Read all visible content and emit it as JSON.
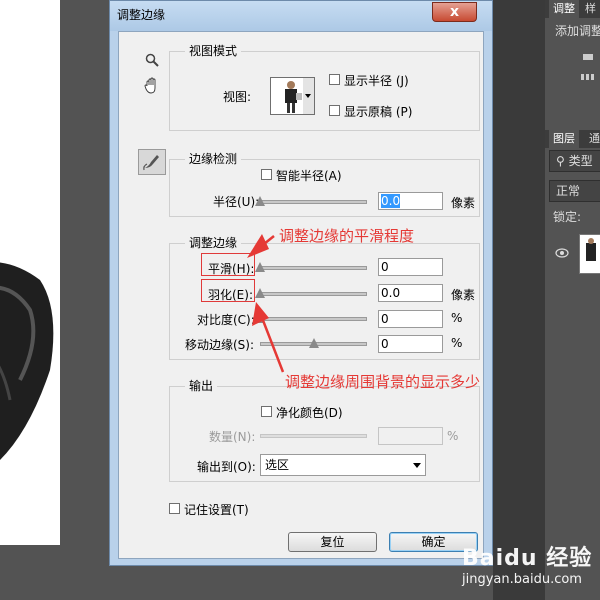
{
  "right_panel": {
    "tabs_top": [
      "调整",
      "样"
    ],
    "add_adjustment": "添加调整",
    "tabs_layers": [
      "图层",
      "通"
    ],
    "kind_filter": "类型",
    "blend_mode": "正常",
    "lock_label": "锁定:"
  },
  "dialog": {
    "title": "调整边缘",
    "close_label": "x",
    "view_mode": {
      "group_title": "视图模式",
      "view_label": "视图:",
      "show_radius": "显示半径 (J)",
      "show_original": "显示原稿 (P)"
    },
    "edge_detection": {
      "group_title": "边缘检测",
      "smart_radius": "智能半径(A)",
      "radius_label": "半径(U):",
      "radius_value": "0.0",
      "radius_unit": "像素",
      "radius_slider_fraction": 0.0
    },
    "adjust_edge": {
      "group_title": "调整边缘",
      "smooth_label": "平滑(H):",
      "smooth_value": "0",
      "smooth_slider_fraction": 0.0,
      "feather_label": "羽化(E):",
      "feather_value": "0.0",
      "feather_unit": "像素",
      "feather_slider_fraction": 0.0,
      "contrast_label": "对比度(C):",
      "contrast_value": "0",
      "contrast_unit": "%",
      "contrast_slider_fraction": 0.0,
      "shift_label": "移动边缘(S):",
      "shift_value": "0",
      "shift_unit": "%",
      "shift_slider_fraction": 0.5
    },
    "output": {
      "group_title": "输出",
      "decontaminate": "净化颜色(D)",
      "amount_label": "数量(N):",
      "amount_unit": "%",
      "output_to_label": "输出到(O):",
      "output_to_value": "选区"
    },
    "remember_settings": "记住设置(T)",
    "reset_button": "复位",
    "ok_button": "确定"
  },
  "annotations": {
    "smooth_note": "调整边缘的平滑程度",
    "feather_note": "调整边缘周围背景的显示多少",
    "color": "#e53935"
  },
  "watermark": {
    "logo_text": "Baidu 经验",
    "url": "jingyan.baidu.com"
  }
}
